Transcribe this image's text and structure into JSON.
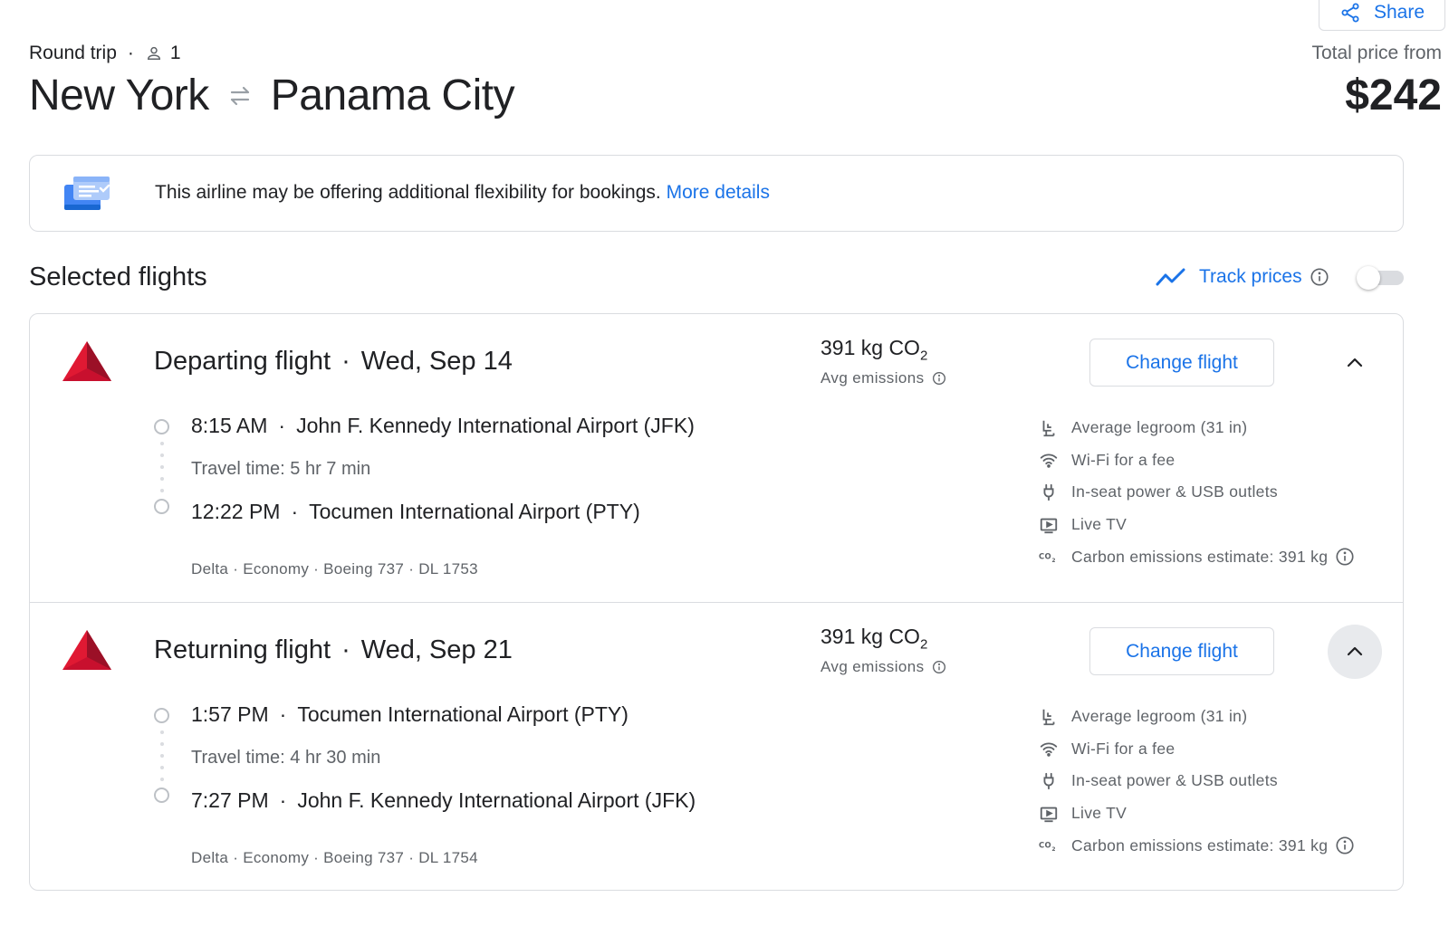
{
  "share": {
    "label": "Share"
  },
  "trip": {
    "type": "Round trip",
    "separator": "·",
    "passengers": "1"
  },
  "route": {
    "origin": "New York",
    "destination": "Panama City"
  },
  "price": {
    "label": "Total price from",
    "value": "$242"
  },
  "banner": {
    "text": "This airline may be offering additional flexibility for bookings.",
    "link": "More details"
  },
  "section": {
    "title": "Selected flights"
  },
  "track": {
    "label": "Track prices",
    "enabled": false
  },
  "flights": [
    {
      "heading": "Departing flight",
      "date": "Wed, Sep 14",
      "co2_value": "391 kg CO",
      "co2_sub": "2",
      "co2_label": "Avg emissions",
      "change_label": "Change flight",
      "dep_time": "8:15 AM",
      "dep_airport": "John F. Kennedy International Airport (JFK)",
      "travel_time": "Travel time: 5 hr 7 min",
      "arr_time": "12:22 PM",
      "arr_airport": "Tocumen International Airport (PTY)",
      "details": "Delta · Economy · Boeing 737 · DL 1753",
      "amenities": [
        "Average legroom (31 in)",
        "Wi-Fi for a fee",
        "In-seat power & USB outlets",
        "Live TV",
        "Carbon emissions estimate: 391 kg"
      ]
    },
    {
      "heading": "Returning flight",
      "date": "Wed, Sep 21",
      "co2_value": "391 kg CO",
      "co2_sub": "2",
      "co2_label": "Avg emissions",
      "change_label": "Change flight",
      "dep_time": "1:57 PM",
      "dep_airport": "Tocumen International Airport (PTY)",
      "travel_time": "Travel time: 4 hr 30 min",
      "arr_time": "7:27 PM",
      "arr_airport": "John F. Kennedy International Airport (JFK)",
      "details": "Delta · Economy · Boeing 737 · DL 1754",
      "amenities": [
        "Average legroom (31 in)",
        "Wi-Fi for a fee",
        "In-seat power & USB outlets",
        "Live TV",
        "Carbon emissions estimate: 391 kg"
      ]
    }
  ],
  "colors": {
    "accent": "#1a73e8",
    "delta_red": "#c8102e",
    "border": "#dadce0",
    "muted": "#5f6368"
  }
}
